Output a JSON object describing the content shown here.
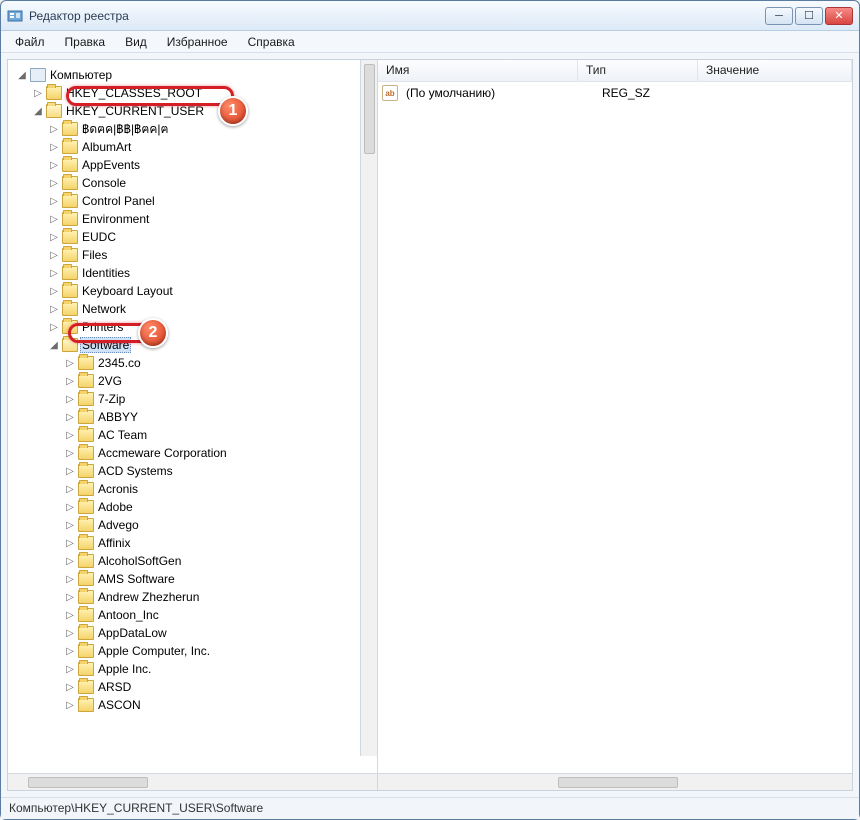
{
  "window": {
    "title": "Редактор реестра"
  },
  "menu": {
    "file": "Файл",
    "edit": "Правка",
    "view": "Вид",
    "favorites": "Избранное",
    "help": "Справка"
  },
  "columns": {
    "name": "Имя",
    "type": "Тип",
    "value": "Значение"
  },
  "values": [
    {
      "name": "(По умолчанию)",
      "type": "REG_SZ",
      "value": ""
    }
  ],
  "tree": {
    "root": "Компьютер",
    "hkcr": "HKEY_CLASSES_ROOT",
    "hkcu": "HKEY_CURRENT_USER",
    "hkcu_children": [
      "฿ดฅค|฿฿|฿ฅค|ฅ",
      "AlbumArt",
      "AppEvents",
      "Console",
      "Control Panel",
      "Environment",
      "EUDC",
      "Files",
      "Identities",
      "Keyboard Layout",
      "Network",
      "Printers"
    ],
    "software": "Software",
    "software_children": [
      "2345.co",
      "2VG",
      "7-Zip",
      "ABBYY",
      "AC Team",
      "Accmeware Corporation",
      "ACD Systems",
      "Acronis",
      "Adobe",
      "Advego",
      "Affinix",
      "AlcoholSoftGen",
      "AMS Software",
      "Andrew Zhezherun",
      "Antoon_Inc",
      "AppDataLow",
      "Apple Computer, Inc.",
      "Apple Inc.",
      "ARSD",
      "ASCON"
    ]
  },
  "statusbar": "Компьютер\\HKEY_CURRENT_USER\\Software",
  "callouts": {
    "badge1": "1",
    "badge2": "2"
  }
}
